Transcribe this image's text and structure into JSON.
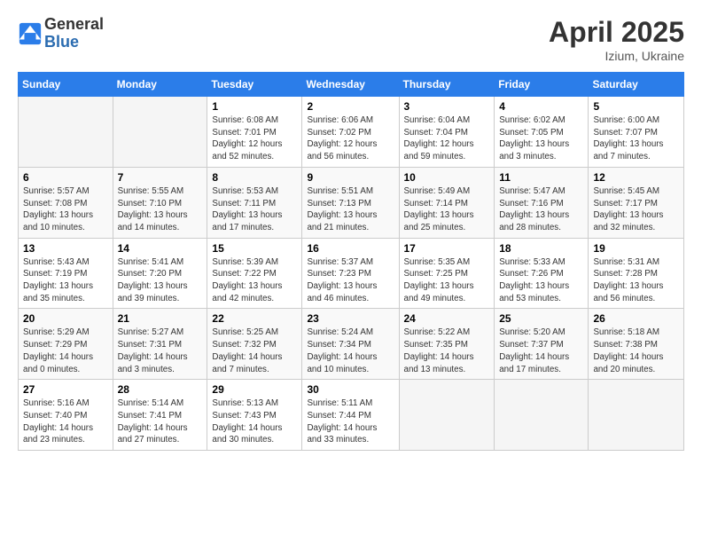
{
  "logo": {
    "general": "General",
    "blue": "Blue"
  },
  "title": "April 2025",
  "location": "Izium, Ukraine",
  "days_header": [
    "Sunday",
    "Monday",
    "Tuesday",
    "Wednesday",
    "Thursday",
    "Friday",
    "Saturday"
  ],
  "weeks": [
    [
      {
        "day": "",
        "info": ""
      },
      {
        "day": "",
        "info": ""
      },
      {
        "day": "1",
        "info": "Sunrise: 6:08 AM\nSunset: 7:01 PM\nDaylight: 12 hours\nand 52 minutes."
      },
      {
        "day": "2",
        "info": "Sunrise: 6:06 AM\nSunset: 7:02 PM\nDaylight: 12 hours\nand 56 minutes."
      },
      {
        "day": "3",
        "info": "Sunrise: 6:04 AM\nSunset: 7:04 PM\nDaylight: 12 hours\nand 59 minutes."
      },
      {
        "day": "4",
        "info": "Sunrise: 6:02 AM\nSunset: 7:05 PM\nDaylight: 13 hours\nand 3 minutes."
      },
      {
        "day": "5",
        "info": "Sunrise: 6:00 AM\nSunset: 7:07 PM\nDaylight: 13 hours\nand 7 minutes."
      }
    ],
    [
      {
        "day": "6",
        "info": "Sunrise: 5:57 AM\nSunset: 7:08 PM\nDaylight: 13 hours\nand 10 minutes."
      },
      {
        "day": "7",
        "info": "Sunrise: 5:55 AM\nSunset: 7:10 PM\nDaylight: 13 hours\nand 14 minutes."
      },
      {
        "day": "8",
        "info": "Sunrise: 5:53 AM\nSunset: 7:11 PM\nDaylight: 13 hours\nand 17 minutes."
      },
      {
        "day": "9",
        "info": "Sunrise: 5:51 AM\nSunset: 7:13 PM\nDaylight: 13 hours\nand 21 minutes."
      },
      {
        "day": "10",
        "info": "Sunrise: 5:49 AM\nSunset: 7:14 PM\nDaylight: 13 hours\nand 25 minutes."
      },
      {
        "day": "11",
        "info": "Sunrise: 5:47 AM\nSunset: 7:16 PM\nDaylight: 13 hours\nand 28 minutes."
      },
      {
        "day": "12",
        "info": "Sunrise: 5:45 AM\nSunset: 7:17 PM\nDaylight: 13 hours\nand 32 minutes."
      }
    ],
    [
      {
        "day": "13",
        "info": "Sunrise: 5:43 AM\nSunset: 7:19 PM\nDaylight: 13 hours\nand 35 minutes."
      },
      {
        "day": "14",
        "info": "Sunrise: 5:41 AM\nSunset: 7:20 PM\nDaylight: 13 hours\nand 39 minutes."
      },
      {
        "day": "15",
        "info": "Sunrise: 5:39 AM\nSunset: 7:22 PM\nDaylight: 13 hours\nand 42 minutes."
      },
      {
        "day": "16",
        "info": "Sunrise: 5:37 AM\nSunset: 7:23 PM\nDaylight: 13 hours\nand 46 minutes."
      },
      {
        "day": "17",
        "info": "Sunrise: 5:35 AM\nSunset: 7:25 PM\nDaylight: 13 hours\nand 49 minutes."
      },
      {
        "day": "18",
        "info": "Sunrise: 5:33 AM\nSunset: 7:26 PM\nDaylight: 13 hours\nand 53 minutes."
      },
      {
        "day": "19",
        "info": "Sunrise: 5:31 AM\nSunset: 7:28 PM\nDaylight: 13 hours\nand 56 minutes."
      }
    ],
    [
      {
        "day": "20",
        "info": "Sunrise: 5:29 AM\nSunset: 7:29 PM\nDaylight: 14 hours\nand 0 minutes."
      },
      {
        "day": "21",
        "info": "Sunrise: 5:27 AM\nSunset: 7:31 PM\nDaylight: 14 hours\nand 3 minutes."
      },
      {
        "day": "22",
        "info": "Sunrise: 5:25 AM\nSunset: 7:32 PM\nDaylight: 14 hours\nand 7 minutes."
      },
      {
        "day": "23",
        "info": "Sunrise: 5:24 AM\nSunset: 7:34 PM\nDaylight: 14 hours\nand 10 minutes."
      },
      {
        "day": "24",
        "info": "Sunrise: 5:22 AM\nSunset: 7:35 PM\nDaylight: 14 hours\nand 13 minutes."
      },
      {
        "day": "25",
        "info": "Sunrise: 5:20 AM\nSunset: 7:37 PM\nDaylight: 14 hours\nand 17 minutes."
      },
      {
        "day": "26",
        "info": "Sunrise: 5:18 AM\nSunset: 7:38 PM\nDaylight: 14 hours\nand 20 minutes."
      }
    ],
    [
      {
        "day": "27",
        "info": "Sunrise: 5:16 AM\nSunset: 7:40 PM\nDaylight: 14 hours\nand 23 minutes."
      },
      {
        "day": "28",
        "info": "Sunrise: 5:14 AM\nSunset: 7:41 PM\nDaylight: 14 hours\nand 27 minutes."
      },
      {
        "day": "29",
        "info": "Sunrise: 5:13 AM\nSunset: 7:43 PM\nDaylight: 14 hours\nand 30 minutes."
      },
      {
        "day": "30",
        "info": "Sunrise: 5:11 AM\nSunset: 7:44 PM\nDaylight: 14 hours\nand 33 minutes."
      },
      {
        "day": "",
        "info": ""
      },
      {
        "day": "",
        "info": ""
      },
      {
        "day": "",
        "info": ""
      }
    ]
  ]
}
